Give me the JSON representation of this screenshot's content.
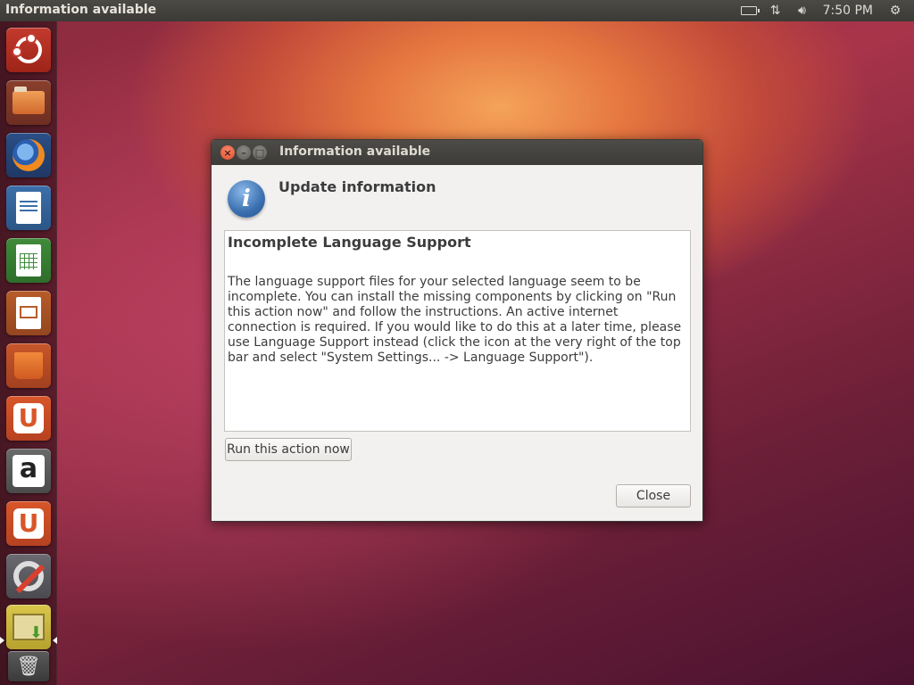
{
  "top_panel": {
    "title": "Information available",
    "clock": "7:50 PM",
    "indicators": [
      "keyboard-battery-icon",
      "network-updown-icon",
      "volume-icon",
      "session-gear-icon"
    ]
  },
  "launcher": {
    "items": [
      "dash-home",
      "files",
      "firefox",
      "libreoffice-writer",
      "libreoffice-calc",
      "libreoffice-impress",
      "ubuntu-software-center",
      "ubuntu-one",
      "amazon",
      "ubuntu-one-music",
      "system-settings",
      "update-manager",
      "trash"
    ]
  },
  "dialog": {
    "title": "Information available",
    "heading": "Update information",
    "content_title": "Incomplete Language Support",
    "content_body": "The language support files for your selected language seem to be incomplete. You can install the missing components by clicking on \"Run this action now\" and follow the instructions. An active internet connection is required. If you would like to do this at a later time, please use Language Support instead (click the icon at the very right of the top bar and select \"System Settings... -> Language Support\").",
    "run_button": "Run this action now",
    "close_button": "Close"
  }
}
